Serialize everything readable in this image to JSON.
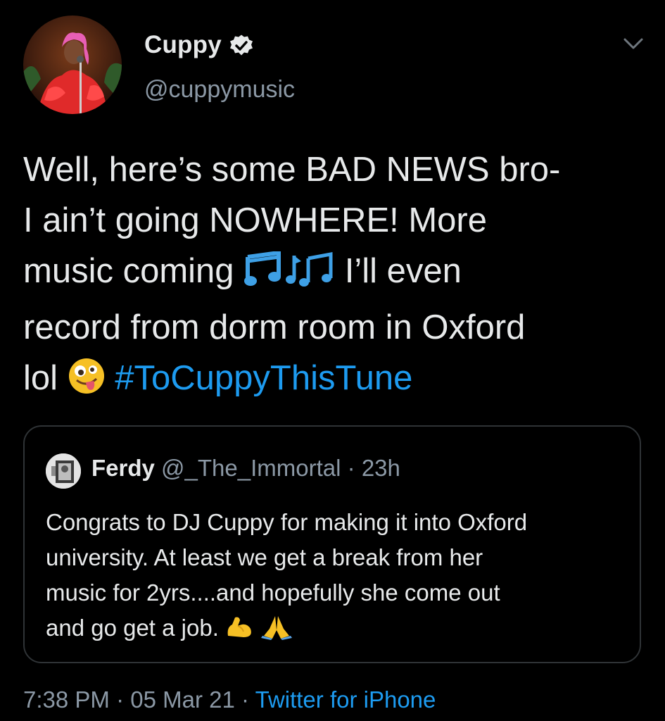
{
  "author": {
    "display_name": "Cuppy",
    "handle": "@cuppymusic",
    "verified": true
  },
  "tweet": {
    "line1": "Well, here’s some BAD NEWS bro-",
    "line2": "I ain’t going NOWHERE! More",
    "line3_before": "music coming",
    "line3_after": "I’ll even",
    "line4": "record from dorm room in Oxford",
    "line5_before": "lol",
    "hashtag": "#ToCuppyThisTune",
    "emojis": [
      "musical-notes-emoji",
      "zany-face-emoji"
    ]
  },
  "quoted_tweet": {
    "display_name": "Ferdy",
    "handle": "@_The_Immortal",
    "separator": "·",
    "time": "23h",
    "line1": "Congrats to DJ Cuppy for making it into Oxford",
    "line2": "university. At least we get a break from her",
    "line3": "music for 2yrs....and hopefully she come out",
    "line4": "and go get a job.",
    "emojis": [
      "flexed-biceps-emoji",
      "folded-hands-emoji"
    ]
  },
  "meta": {
    "time": "7:38 PM",
    "sep1": "·",
    "date": "05 Mar 21",
    "sep2": "·",
    "source": "Twitter for iPhone"
  },
  "colors": {
    "background": "#000000",
    "text": "#e7e9ea",
    "secondary_text": "#8b98a5",
    "link": "#1d9bf0",
    "card_border": "#2f3336"
  }
}
